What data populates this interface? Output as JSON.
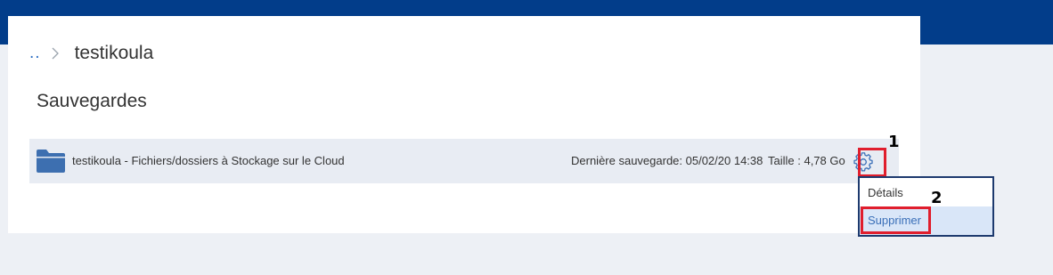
{
  "breadcrumb": {
    "back_label": "..",
    "separator_icon": "chevron-right-icon",
    "current": "testikoula"
  },
  "section": {
    "title": "Sauvegardes"
  },
  "backup": {
    "icon": "folder-icon",
    "name": "testikoula - Fichiers/dossiers à Stockage sur le Cloud",
    "last_backup": "Dernière sauvegarde: 05/02/20 14:38",
    "size": "Taille : 4,78 Go",
    "settings_icon": "gear-icon"
  },
  "context_menu": {
    "items": [
      {
        "label": "Détails"
      },
      {
        "label": "Supprimer",
        "highlighted": true
      }
    ]
  },
  "annotations": {
    "marker_1": "1",
    "marker_2": "2"
  },
  "colors": {
    "top_bar": "#023d8a",
    "page_background": "#edf0f5",
    "row_background": "#e8ecf3",
    "link": "#2e6fc4",
    "annotation_red": "#e01e2d",
    "menu_selected": "#d9e6f8"
  }
}
